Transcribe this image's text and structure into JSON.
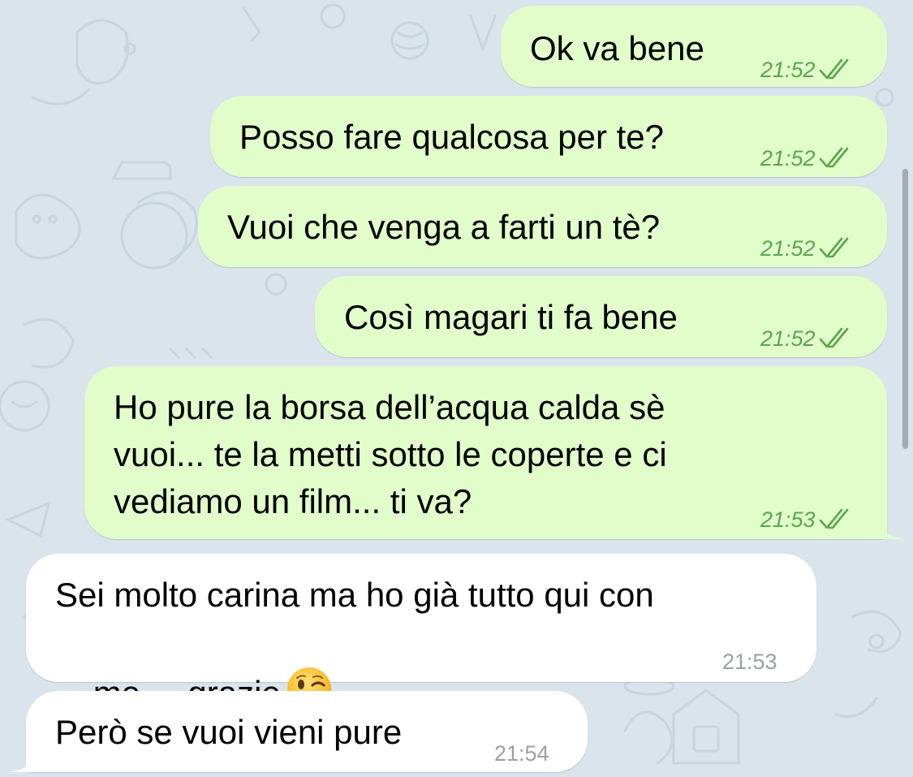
{
  "messages": [
    {
      "direction": "outgoing",
      "text": "Ok va bene",
      "time": "21:52",
      "read": true
    },
    {
      "direction": "outgoing",
      "text": "Posso fare qualcosa per te?",
      "time": "21:52",
      "read": true
    },
    {
      "direction": "outgoing",
      "text": "Vuoi che venga a farti un tè?",
      "time": "21:52",
      "read": true
    },
    {
      "direction": "outgoing",
      "text": "Così magari ti fa bene",
      "time": "21:52",
      "read": true
    },
    {
      "direction": "outgoing",
      "lines": [
        "Ho pure la borsa dell’acqua calda sè",
        "vuoi... te la metti sotto le coperte e ci",
        "vediamo un film... ti va?"
      ],
      "time": "21:53",
      "read": true
    },
    {
      "direction": "incoming",
      "lines": [
        "Sei molto carina ma ho già tutto qui con",
        "me ... grazie"
      ],
      "emoji": "winking-face",
      "time": "21:53"
    },
    {
      "direction": "incoming",
      "text": "Però se vuoi vieni pure",
      "time": "21:54"
    }
  ],
  "colors": {
    "background": "#d9e4ec",
    "outgoing_bubble": "#e1fdca",
    "incoming_bubble": "#ffffff",
    "outgoing_time": "#5ba54f",
    "incoming_time": "#9aa0a6"
  },
  "icons": {
    "read_receipt": "double-check-icon",
    "emoji": "winking-face-emoji"
  }
}
